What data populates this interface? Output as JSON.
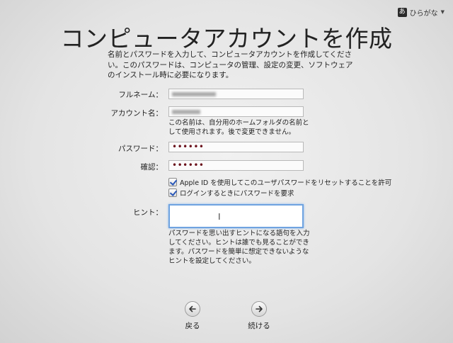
{
  "input_menu": {
    "badge": "あ",
    "label": "ひらがな",
    "caret": "▼"
  },
  "title": "コンピュータアカウントを作成",
  "description": [
    "名前とパスワードを入力して、コンピュータアカウントを作成してくださ",
    "い。このパスワードは、コンピュータの管理、設定の変更、ソフトウェア",
    "のインストール時に必要になります。"
  ],
  "form": {
    "fullname_label": "フルネーム：",
    "account_label": "アカウント名：",
    "account_note": [
      "この名前は、自分用のホームフォルダの名前と",
      "して使用されます。後で変更できません。"
    ],
    "password_label": "パスワード：",
    "password_value": "••••••",
    "verify_label": "確認：",
    "verify_value": "••••••",
    "checkbox_reset": "Apple ID を使用してこのユーザパスワードをリセットすることを許可",
    "checkbox_login": "ログインするときにパスワードを要求",
    "hint_label": "ヒント：",
    "hint_value": "",
    "hint_note": [
      "パスワードを思い出すヒントになる語句を入力",
      "してください。ヒントは誰でも見ることができ",
      "ます。パスワードを簡単に想定できないような",
      "ヒントを設定してください。"
    ]
  },
  "nav": {
    "back_label": "戻る",
    "continue_label": "続ける"
  }
}
